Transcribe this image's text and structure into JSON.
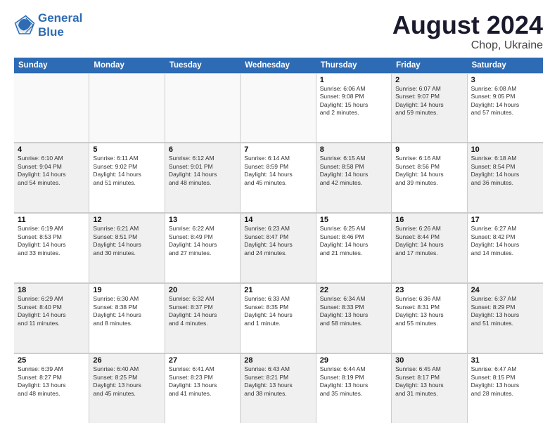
{
  "logo": {
    "line1": "General",
    "line2": "Blue"
  },
  "title": "August 2024",
  "subtitle": "Chop, Ukraine",
  "header_days": [
    "Sunday",
    "Monday",
    "Tuesday",
    "Wednesday",
    "Thursday",
    "Friday",
    "Saturday"
  ],
  "weeks": [
    [
      {
        "day": "",
        "text": "",
        "shaded": true,
        "empty": true
      },
      {
        "day": "",
        "text": "",
        "shaded": true,
        "empty": true
      },
      {
        "day": "",
        "text": "",
        "shaded": true,
        "empty": true
      },
      {
        "day": "",
        "text": "",
        "shaded": true,
        "empty": true
      },
      {
        "day": "1",
        "text": "Sunrise: 6:06 AM\nSunset: 9:08 PM\nDaylight: 15 hours\nand 2 minutes."
      },
      {
        "day": "2",
        "text": "Sunrise: 6:07 AM\nSunset: 9:07 PM\nDaylight: 14 hours\nand 59 minutes.",
        "shaded": true
      },
      {
        "day": "3",
        "text": "Sunrise: 6:08 AM\nSunset: 9:05 PM\nDaylight: 14 hours\nand 57 minutes."
      }
    ],
    [
      {
        "day": "4",
        "text": "Sunrise: 6:10 AM\nSunset: 9:04 PM\nDaylight: 14 hours\nand 54 minutes.",
        "shaded": true
      },
      {
        "day": "5",
        "text": "Sunrise: 6:11 AM\nSunset: 9:02 PM\nDaylight: 14 hours\nand 51 minutes."
      },
      {
        "day": "6",
        "text": "Sunrise: 6:12 AM\nSunset: 9:01 PM\nDaylight: 14 hours\nand 48 minutes.",
        "shaded": true
      },
      {
        "day": "7",
        "text": "Sunrise: 6:14 AM\nSunset: 8:59 PM\nDaylight: 14 hours\nand 45 minutes."
      },
      {
        "day": "8",
        "text": "Sunrise: 6:15 AM\nSunset: 8:58 PM\nDaylight: 14 hours\nand 42 minutes.",
        "shaded": true
      },
      {
        "day": "9",
        "text": "Sunrise: 6:16 AM\nSunset: 8:56 PM\nDaylight: 14 hours\nand 39 minutes."
      },
      {
        "day": "10",
        "text": "Sunrise: 6:18 AM\nSunset: 8:54 PM\nDaylight: 14 hours\nand 36 minutes.",
        "shaded": true
      }
    ],
    [
      {
        "day": "11",
        "text": "Sunrise: 6:19 AM\nSunset: 8:53 PM\nDaylight: 14 hours\nand 33 minutes."
      },
      {
        "day": "12",
        "text": "Sunrise: 6:21 AM\nSunset: 8:51 PM\nDaylight: 14 hours\nand 30 minutes.",
        "shaded": true
      },
      {
        "day": "13",
        "text": "Sunrise: 6:22 AM\nSunset: 8:49 PM\nDaylight: 14 hours\nand 27 minutes."
      },
      {
        "day": "14",
        "text": "Sunrise: 6:23 AM\nSunset: 8:47 PM\nDaylight: 14 hours\nand 24 minutes.",
        "shaded": true
      },
      {
        "day": "15",
        "text": "Sunrise: 6:25 AM\nSunset: 8:46 PM\nDaylight: 14 hours\nand 21 minutes."
      },
      {
        "day": "16",
        "text": "Sunrise: 6:26 AM\nSunset: 8:44 PM\nDaylight: 14 hours\nand 17 minutes.",
        "shaded": true
      },
      {
        "day": "17",
        "text": "Sunrise: 6:27 AM\nSunset: 8:42 PM\nDaylight: 14 hours\nand 14 minutes."
      }
    ],
    [
      {
        "day": "18",
        "text": "Sunrise: 6:29 AM\nSunset: 8:40 PM\nDaylight: 14 hours\nand 11 minutes.",
        "shaded": true
      },
      {
        "day": "19",
        "text": "Sunrise: 6:30 AM\nSunset: 8:38 PM\nDaylight: 14 hours\nand 8 minutes."
      },
      {
        "day": "20",
        "text": "Sunrise: 6:32 AM\nSunset: 8:37 PM\nDaylight: 14 hours\nand 4 minutes.",
        "shaded": true
      },
      {
        "day": "21",
        "text": "Sunrise: 6:33 AM\nSunset: 8:35 PM\nDaylight: 14 hours\nand 1 minute."
      },
      {
        "day": "22",
        "text": "Sunrise: 6:34 AM\nSunset: 8:33 PM\nDaylight: 13 hours\nand 58 minutes.",
        "shaded": true
      },
      {
        "day": "23",
        "text": "Sunrise: 6:36 AM\nSunset: 8:31 PM\nDaylight: 13 hours\nand 55 minutes."
      },
      {
        "day": "24",
        "text": "Sunrise: 6:37 AM\nSunset: 8:29 PM\nDaylight: 13 hours\nand 51 minutes.",
        "shaded": true
      }
    ],
    [
      {
        "day": "25",
        "text": "Sunrise: 6:39 AM\nSunset: 8:27 PM\nDaylight: 13 hours\nand 48 minutes."
      },
      {
        "day": "26",
        "text": "Sunrise: 6:40 AM\nSunset: 8:25 PM\nDaylight: 13 hours\nand 45 minutes.",
        "shaded": true
      },
      {
        "day": "27",
        "text": "Sunrise: 6:41 AM\nSunset: 8:23 PM\nDaylight: 13 hours\nand 41 minutes."
      },
      {
        "day": "28",
        "text": "Sunrise: 6:43 AM\nSunset: 8:21 PM\nDaylight: 13 hours\nand 38 minutes.",
        "shaded": true
      },
      {
        "day": "29",
        "text": "Sunrise: 6:44 AM\nSunset: 8:19 PM\nDaylight: 13 hours\nand 35 minutes."
      },
      {
        "day": "30",
        "text": "Sunrise: 6:45 AM\nSunset: 8:17 PM\nDaylight: 13 hours\nand 31 minutes.",
        "shaded": true
      },
      {
        "day": "31",
        "text": "Sunrise: 6:47 AM\nSunset: 8:15 PM\nDaylight: 13 hours\nand 28 minutes."
      }
    ]
  ]
}
